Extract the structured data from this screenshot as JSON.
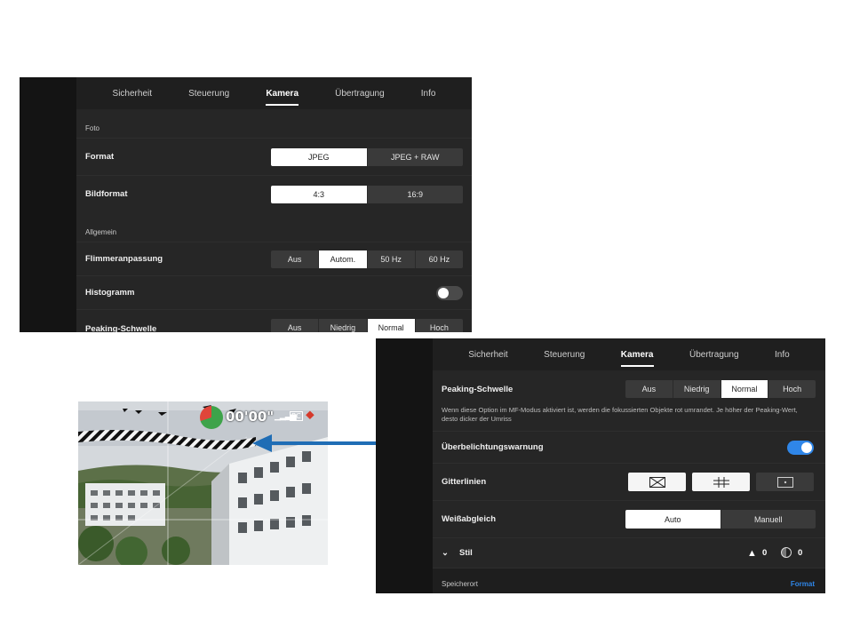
{
  "tabs": [
    "Sicherheit",
    "Steuerung",
    "Kamera",
    "Übertragung",
    "Info"
  ],
  "active_tab": "Kamera",
  "panel1": {
    "section_foto": "Foto",
    "format": {
      "label": "Format",
      "options": [
        "JPEG",
        "JPEG + RAW"
      ],
      "selected": "JPEG"
    },
    "bildformat": {
      "label": "Bildformat",
      "options": [
        "4:3",
        "16:9"
      ],
      "selected": "4:3"
    },
    "section_allgemein": "Allgemein",
    "flimmer": {
      "label": "Flimmeranpassung",
      "options": [
        "Aus",
        "Autom.",
        "50 Hz",
        "60 Hz"
      ],
      "selected": "Autom."
    },
    "histogramm": {
      "label": "Histogramm",
      "enabled": false
    },
    "peaking": {
      "label": "Peaking-Schwelle",
      "options": [
        "Aus",
        "Niedrig",
        "Normal",
        "Hoch"
      ],
      "selected": "Normal"
    }
  },
  "panel2": {
    "peaking": {
      "label": "Peaking-Schwelle",
      "options": [
        "Aus",
        "Niedrig",
        "Normal",
        "Hoch"
      ],
      "selected": "Normal"
    },
    "peaking_desc": "Wenn diese Option im MF-Modus aktiviert ist, werden die fokussierten Objekte rot umrandet. Je höher der Peaking-Wert, desto dicker der Umriss",
    "overexposure": {
      "label": "Überbelichtungswarnung",
      "enabled": true
    },
    "gridlines": {
      "label": "Gitterlinien"
    },
    "whitebalance": {
      "label": "Weißabgleich",
      "options": [
        "Auto",
        "Manuell"
      ],
      "selected": "Auto"
    },
    "style": {
      "label": "Stil",
      "value_a": "0",
      "value_b": "0"
    },
    "storage": {
      "label": "Speicherort",
      "action": "Format"
    }
  },
  "photo_osd": {
    "timer": "00'00\"",
    "rc": "RC"
  },
  "colors": {
    "accent_blue": "#2f86e8",
    "arrow_blue": "#1f6db5"
  }
}
